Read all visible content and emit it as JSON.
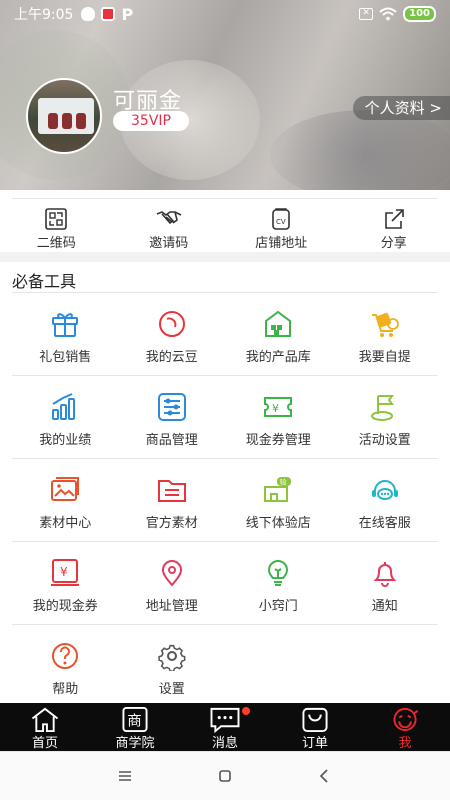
{
  "status_bar": {
    "time": "上午9:05",
    "battery": "100"
  },
  "profile": {
    "name": "可丽金",
    "vip": "35VIP",
    "profile_link": "个人资料 >"
  },
  "quick_tools": [
    {
      "label": "二维码",
      "icon": "qrcode-icon"
    },
    {
      "label": "邀请码",
      "icon": "handshake-icon"
    },
    {
      "label": "店铺地址",
      "icon": "shop-cv-icon"
    },
    {
      "label": "分享",
      "icon": "share-icon"
    }
  ],
  "essentials": {
    "title": "必备工具",
    "items": [
      {
        "label": "礼包销售",
        "icon": "gift-icon",
        "color": "#2a8bdc"
      },
      {
        "label": "我的云豆",
        "icon": "bean-icon",
        "color": "#e8353c"
      },
      {
        "label": "我的产品库",
        "icon": "warehouse-icon",
        "color": "#3cb44a"
      },
      {
        "label": "我要自提",
        "icon": "cart-pickup-icon",
        "color": "#f2b01e"
      },
      {
        "label": "我的业绩",
        "icon": "bar-chart-icon",
        "color": "#2a8bdc"
      },
      {
        "label": "商品管理",
        "icon": "sliders-icon",
        "color": "#2a8bdc"
      },
      {
        "label": "现金券管理",
        "icon": "ticket-icon",
        "color": "#3cb44a"
      },
      {
        "label": "活动设置",
        "icon": "flag-icon",
        "color": "#8cc43c"
      },
      {
        "label": "素材中心",
        "icon": "image-icon",
        "color": "#e8532b"
      },
      {
        "label": "官方素材",
        "icon": "folder-list-icon",
        "color": "#e8353c"
      },
      {
        "label": "线下体验店",
        "icon": "experience-store-icon",
        "color": "#8cc43c"
      },
      {
        "label": "在线客服",
        "icon": "headset-chat-icon",
        "color": "#20b6c9"
      },
      {
        "label": "我的现金券",
        "icon": "coupon-icon",
        "color": "#e8353c"
      },
      {
        "label": "地址管理",
        "icon": "location-pin-icon",
        "color": "#e03a5e"
      },
      {
        "label": "小窍门",
        "icon": "lightbulb-icon",
        "color": "#3cb44a"
      },
      {
        "label": "通知",
        "icon": "bell-icon",
        "color": "#e03a5e"
      },
      {
        "label": "帮助",
        "icon": "help-icon",
        "color": "#e8532b"
      },
      {
        "label": "设置",
        "icon": "gear-icon",
        "color": "#555555"
      }
    ]
  },
  "bottom_nav": [
    {
      "label": "首页",
      "icon": "home-icon",
      "active": false
    },
    {
      "label": "商学院",
      "icon": "academy-icon",
      "active": false
    },
    {
      "label": "消息",
      "icon": "message-icon",
      "active": false,
      "badge": true
    },
    {
      "label": "订单",
      "icon": "order-bag-icon",
      "active": false
    },
    {
      "label": "我",
      "icon": "me-face-icon",
      "active": true
    }
  ],
  "colors": {
    "accent": "#e8282d",
    "nav_bg": "#0c0c0c",
    "vip_text": "#e0304a"
  }
}
